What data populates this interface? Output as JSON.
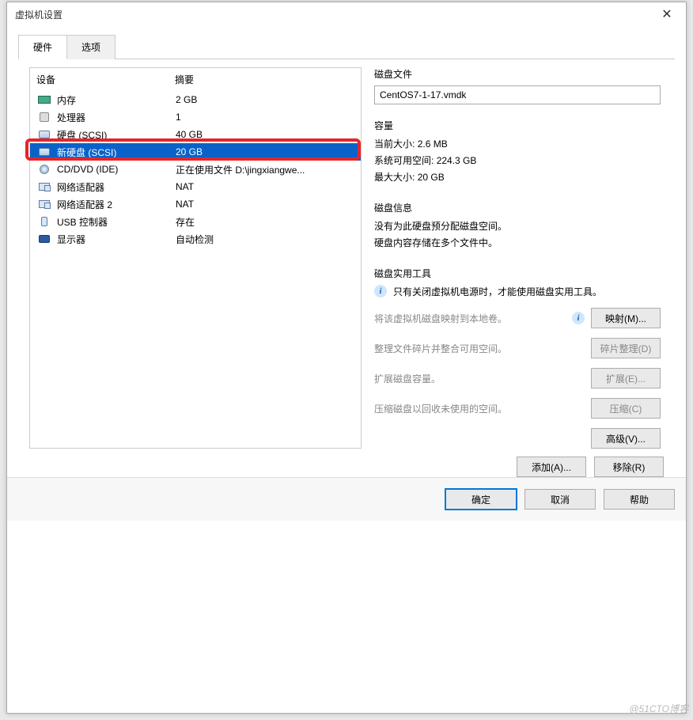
{
  "window": {
    "title": "虚拟机设置"
  },
  "tabs": {
    "hardware": "硬件",
    "options": "选项"
  },
  "device_header": {
    "device": "设备",
    "summary": "摘要"
  },
  "devices": [
    {
      "icon": "ico-mem",
      "name_key": "memory",
      "name": "内存",
      "summary": "2 GB",
      "selected": false
    },
    {
      "icon": "ico-cpu",
      "name_key": "cpu",
      "name": "处理器",
      "summary": "1",
      "selected": false
    },
    {
      "icon": "ico-disk",
      "name_key": "disk1",
      "name": "硬盘 (SCSI)",
      "summary": "40 GB",
      "selected": false
    },
    {
      "icon": "ico-disk",
      "name_key": "disk2",
      "name": "新硬盘 (SCSI)",
      "summary": "20 GB",
      "selected": true
    },
    {
      "icon": "ico-cd",
      "name_key": "cddvd",
      "name": "CD/DVD (IDE)",
      "summary": "正在使用文件 D:\\jingxiangwe...",
      "selected": false
    },
    {
      "icon": "ico-net",
      "name_key": "net1",
      "name": "网络适配器",
      "summary": "NAT",
      "selected": false
    },
    {
      "icon": "ico-net",
      "name_key": "net2",
      "name": "网络适配器 2",
      "summary": "NAT",
      "selected": false
    },
    {
      "icon": "ico-usb",
      "name_key": "usb",
      "name": "USB 控制器",
      "summary": "存在",
      "selected": false
    },
    {
      "icon": "ico-display",
      "name_key": "display",
      "name": "显示器",
      "summary": "自动检测",
      "selected": false
    }
  ],
  "device_buttons": {
    "add": "添加(A)...",
    "remove": "移除(R)"
  },
  "disk_file": {
    "label": "磁盘文件",
    "value": "CentOS7-1-17.vmdk"
  },
  "capacity": {
    "label": "容量",
    "current_size_label": "当前大小:",
    "current_size_value": "2.6 MB",
    "free_space_label": "系统可用空间:",
    "free_space_value": "224.3 GB",
    "max_size_label": "最大大小:",
    "max_size_value": "20 GB"
  },
  "disk_info": {
    "label": "磁盘信息",
    "line1": "没有为此硬盘预分配磁盘空间。",
    "line2": "硬盘内容存储在多个文件中。"
  },
  "disk_tools": {
    "label": "磁盘实用工具",
    "note": "只有关闭虚拟机电源时，才能使用磁盘实用工具。",
    "map_desc": "将该虚拟机磁盘映射到本地卷。",
    "map_btn": "映射(M)...",
    "defrag_desc": "整理文件碎片并整合可用空间。",
    "defrag_btn": "碎片整理(D)",
    "expand_desc": "扩展磁盘容量。",
    "expand_btn": "扩展(E)...",
    "compact_desc": "压缩磁盘以回收未使用的空间。",
    "compact_btn": "压缩(C)",
    "advanced_btn": "高级(V)..."
  },
  "bottom": {
    "ok": "确定",
    "cancel": "取消",
    "help": "帮助"
  },
  "watermark": "@51CTO博客"
}
